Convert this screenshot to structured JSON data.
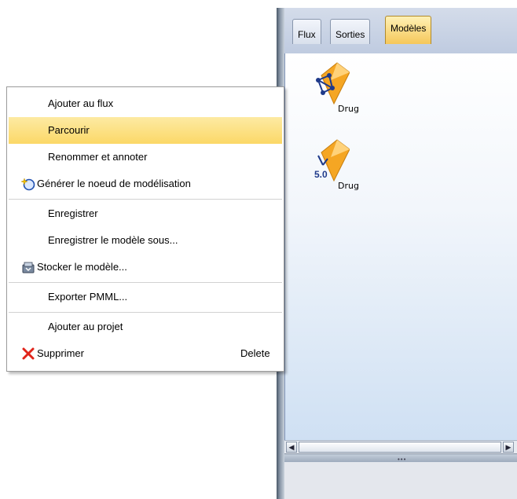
{
  "tabs": [
    {
      "label": "Flux"
    },
    {
      "label": "Sorties"
    },
    {
      "label": "Modèles",
      "active": true
    }
  ],
  "models": [
    {
      "label": "Drug",
      "version": ""
    },
    {
      "label": "Drug",
      "version": "5.0"
    }
  ],
  "menu": {
    "items": [
      {
        "label": "Ajouter au flux"
      },
      {
        "label": "Parcourir",
        "highlighted": true
      },
      {
        "label": "Renommer et annoter"
      },
      {
        "label": "Générer le noeud de modélisation",
        "icon": "generate-icon"
      },
      {
        "label": "Enregistrer"
      },
      {
        "label": "Enregistrer le modèle sous..."
      },
      {
        "label": "Stocker le modèle...",
        "icon": "store-icon"
      },
      {
        "label": "Exporter PMML..."
      },
      {
        "label": "Ajouter au projet"
      },
      {
        "label": "Supprimer",
        "shortcut": "Delete",
        "icon": "delete-icon"
      }
    ]
  },
  "colors": {
    "highlight": "#fbd867",
    "active_tab": "#f5c75a",
    "delete_icon": "#e0241a"
  }
}
